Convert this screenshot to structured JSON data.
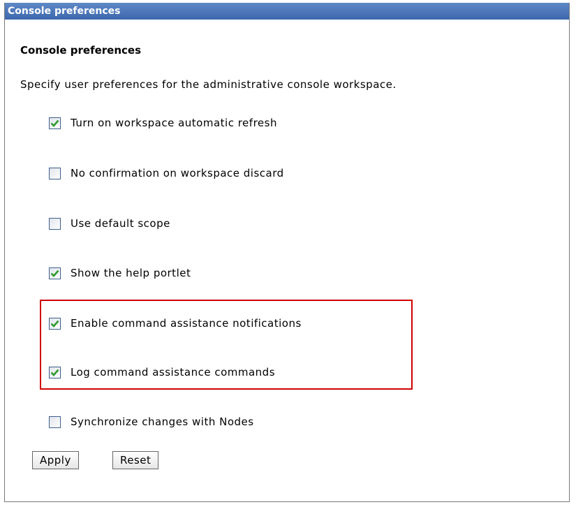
{
  "window": {
    "title": "Console preferences"
  },
  "section": {
    "heading": "Console preferences",
    "description": "Specify user preferences for the administrative console workspace."
  },
  "options": [
    {
      "label": "Turn on workspace automatic refresh",
      "checked": true
    },
    {
      "label": "No confirmation on workspace discard",
      "checked": false
    },
    {
      "label": "Use default scope",
      "checked": false
    },
    {
      "label": "Show the help portlet",
      "checked": true
    },
    {
      "label": "Enable command assistance notifications",
      "checked": true
    },
    {
      "label": "Log command assistance commands",
      "checked": true
    },
    {
      "label": "Synchronize changes with Nodes",
      "checked": false
    }
  ],
  "buttons": {
    "apply": "Apply",
    "reset": "Reset"
  },
  "colors": {
    "titlebar": "#4a74b8",
    "highlight_border": "#d00000",
    "checkmark": "#2e9a2e"
  }
}
